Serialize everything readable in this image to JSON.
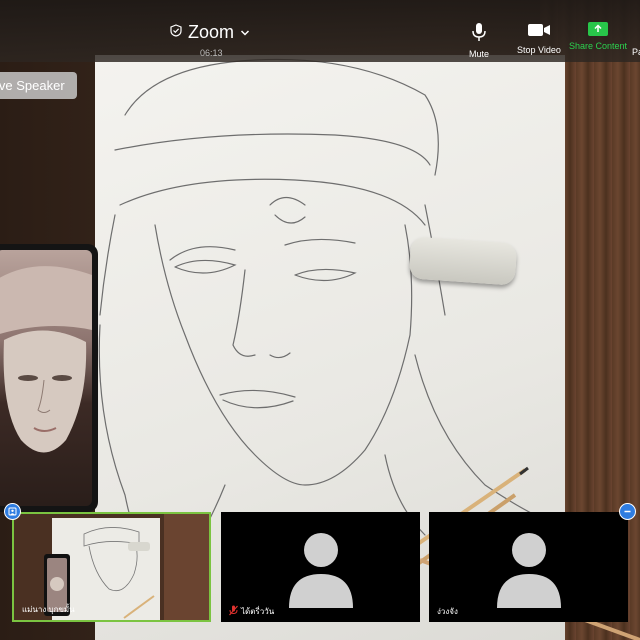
{
  "header": {
    "meeting_title": "Zoom",
    "elapsed_time": "06:13"
  },
  "toolbar": {
    "mute_label": "Mute",
    "stop_video_label": "Stop Video",
    "share_content_label": "Share Content",
    "participants_label": "Pa"
  },
  "view": {
    "speaker_label": "ive Speaker"
  },
  "participants": [
    {
      "name": "แม่นาง บุกขมั้น",
      "muted": false,
      "has_video": true
    },
    {
      "name": "ได้ตรี่ววัน",
      "muted": true,
      "has_video": false
    },
    {
      "name": "ง่วงจัง",
      "muted": false,
      "has_video": false
    }
  ],
  "colors": {
    "share_green": "#28c64a",
    "active_border": "#7bc441",
    "badge_blue": "#2f7de1",
    "muted_red": "#e0322f"
  },
  "icons": {
    "security": "shield-check-icon",
    "title_menu": "chevron-down-icon",
    "mute": "microphone-icon",
    "video": "video-camera-icon",
    "share": "share-arrow-icon",
    "avatar": "person-avatar-icon",
    "muted_mic": "mic-off-icon",
    "badge_left": "pin-icon",
    "badge_right": "minimize-icon"
  }
}
